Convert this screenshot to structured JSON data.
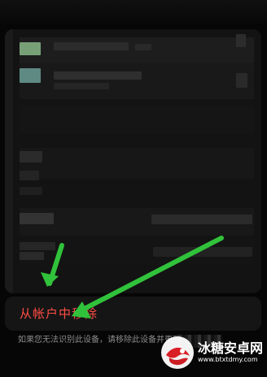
{
  "page": {
    "background_color": "#060606"
  },
  "device_menu": {
    "remove_action": "从帐户中移除",
    "remove_action_color": "#ff4d45",
    "helper_text": "如果您无法识别此设备，请移除此设备并更改"
  },
  "annotations": {
    "arrow_color": "#31c23b"
  },
  "watermark": {
    "title": "冰糖安卓网",
    "url": "www.btxtdmy.com"
  },
  "icons": {
    "arrow": "green-arrow-icon",
    "logo": "watermark-logo-icon"
  }
}
